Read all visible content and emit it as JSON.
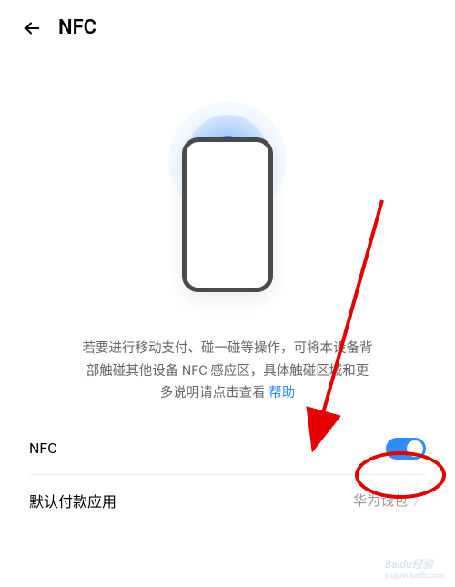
{
  "header": {
    "title": "NFC"
  },
  "description": {
    "text_line1": "若要进行移动支付、碰一碰等操作，可将本设备背",
    "text_line2": "部触碰其他设备 NFC 感应区，具体触碰区域和更",
    "text_line3": "多说明请点击查看 ",
    "help_link": "帮助"
  },
  "settings": {
    "nfc": {
      "label": "NFC",
      "enabled": true
    },
    "default_payment": {
      "label": "默认付款应用",
      "value": "华为钱包"
    }
  },
  "watermark": {
    "main": "Baidu经验",
    "sub": "jingyan.baidu.com"
  }
}
